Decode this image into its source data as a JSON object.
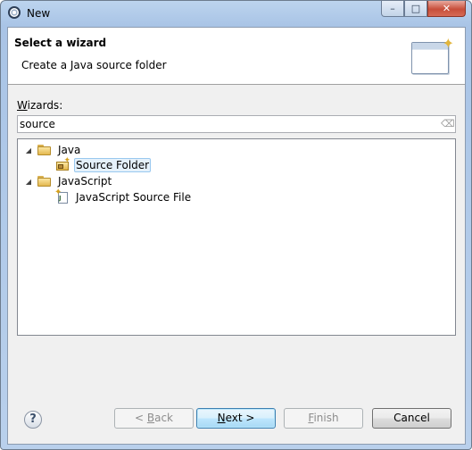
{
  "window": {
    "title": "New"
  },
  "caption_buttons": {
    "minimize": "–",
    "maximize": "□",
    "close": "✕"
  },
  "banner": {
    "title": "Select a wizard",
    "description": "Create a Java source folder"
  },
  "wizards": {
    "label_accel": "W",
    "label_rest": "izards:",
    "filter_value": "source"
  },
  "tree": {
    "items": [
      {
        "label": "Java",
        "expanded": true,
        "icon": "folder-icon"
      },
      {
        "label": "Source Folder",
        "selected": true,
        "icon": "source-folder-icon"
      },
      {
        "label": "JavaScript",
        "expanded": true,
        "icon": "folder-icon"
      },
      {
        "label": "JavaScript Source File",
        "icon": "javascript-file-icon"
      }
    ]
  },
  "footer": {
    "help": "?",
    "back": {
      "prefix": "< ",
      "accel": "B",
      "rest": "ack"
    },
    "next": {
      "accel": "N",
      "rest": "ext >"
    },
    "finish": {
      "accel": "F",
      "rest": "inish"
    },
    "cancel": "Cancel"
  }
}
